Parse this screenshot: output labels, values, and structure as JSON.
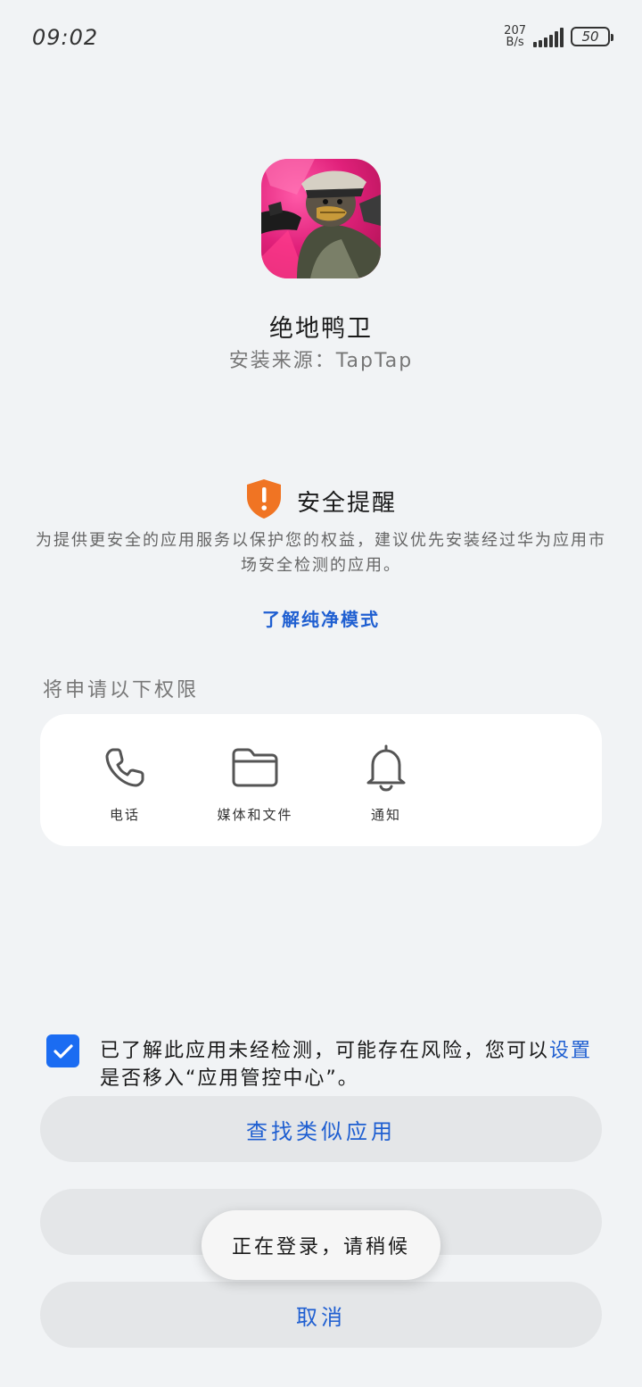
{
  "status_bar": {
    "time": "09:02",
    "net_speed_value": "207",
    "net_speed_unit": "B/s",
    "battery": "50"
  },
  "app": {
    "name": "绝地鸭卫",
    "source": "安装来源：TapTap"
  },
  "safety": {
    "title": "安全提醒",
    "description": "为提供更安全的应用服务以保护您的权益，建议优先安装经过华为应用市场安全检测的应用。",
    "pure_mode_link": "了解纯净模式"
  },
  "permissions": {
    "heading": "将申请以下权限",
    "items": [
      {
        "label": "电话",
        "icon": "phone-icon"
      },
      {
        "label": "媒体和文件",
        "icon": "folder-icon"
      },
      {
        "label": "通知",
        "icon": "bell-icon"
      }
    ]
  },
  "acknowledge": {
    "checked": true,
    "text_before": "已了解此应用未经检测，可能存在风险，您可以",
    "settings_link": "设置",
    "text_after": "是否移入“应用管控中心”。"
  },
  "buttons": {
    "find_similar": "查找类似应用",
    "cancel": "取消"
  },
  "toast": {
    "text": "正在登录，请稍候"
  },
  "colors": {
    "accent": "#1f5fd1",
    "checkbox": "#1b6cf2",
    "warning": "#f07423",
    "background": "#f1f3f5"
  }
}
